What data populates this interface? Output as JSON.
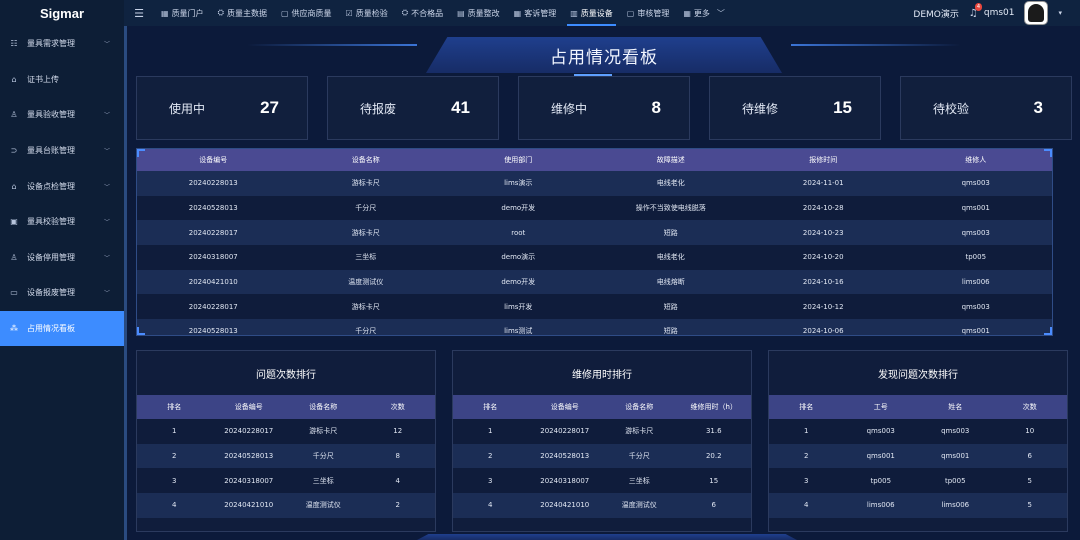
{
  "brand": "Sigmar",
  "nav": [
    {
      "icon": "▦",
      "label": "质量门户"
    },
    {
      "icon": "⛭",
      "label": "质量主数据"
    },
    {
      "icon": "▢",
      "label": "供应商质量"
    },
    {
      "icon": "☑",
      "label": "质量检验"
    },
    {
      "icon": "⛭",
      "label": "不合格品"
    },
    {
      "icon": "▤",
      "label": "质量整改"
    },
    {
      "icon": "▦",
      "label": "客诉管理"
    },
    {
      "icon": "▥",
      "label": "质量设备"
    },
    {
      "icon": "▢",
      "label": "审核管理"
    },
    {
      "icon": "▦",
      "label": "更多"
    }
  ],
  "top_right": {
    "company": "DEMO演示",
    "notifications": "4",
    "user": "qms01"
  },
  "sidebar": [
    {
      "icon": "☷",
      "label": "量具需求管理",
      "chevron": "﹀"
    },
    {
      "icon": "⌂",
      "label": "证书上传",
      "chevron": ""
    },
    {
      "icon": "♙",
      "label": "量具验收管理",
      "chevron": "﹀"
    },
    {
      "icon": "⊃",
      "label": "量具台账管理",
      "chevron": "﹀"
    },
    {
      "icon": "⌂",
      "label": "设备点检管理",
      "chevron": "﹀"
    },
    {
      "icon": "▣",
      "label": "量具校验管理",
      "chevron": "﹀"
    },
    {
      "icon": "♙",
      "label": "设备停用管理",
      "chevron": "﹀"
    },
    {
      "icon": "▭",
      "label": "设备报废管理",
      "chevron": "﹀"
    },
    {
      "icon": "⁂",
      "label": "占用情况看板",
      "chevron": ""
    }
  ],
  "dashboard_title": "占用情况看板",
  "stats": [
    {
      "label": "使用中",
      "value": "27"
    },
    {
      "label": "待报废",
      "value": "41"
    },
    {
      "label": "维修中",
      "value": "8"
    },
    {
      "label": "待维修",
      "value": "15"
    },
    {
      "label": "待校验",
      "value": "3"
    }
  ],
  "repair_table": {
    "headers": [
      "设备编号",
      "设备名称",
      "使用部门",
      "故障描述",
      "报修时间",
      "维修人"
    ],
    "rows": [
      [
        "20240228013",
        "游标卡尺",
        "lims演示",
        "电线老化",
        "2024-11-01",
        "qms003"
      ],
      [
        "20240528013",
        "千分尺",
        "demo开发",
        "操作不当致使电线脱落",
        "2024-10-28",
        "qms001"
      ],
      [
        "20240228017",
        "游标卡尺",
        "root",
        "短路",
        "2024-10-23",
        "qms003"
      ],
      [
        "20240318007",
        "三坐标",
        "demo演示",
        "电线老化",
        "2024-10-20",
        "tp005"
      ],
      [
        "20240421010",
        "温度测试仪",
        "demo开发",
        "电线熔断",
        "2024-10-16",
        "lims006"
      ],
      [
        "20240228017",
        "游标卡尺",
        "lims开发",
        "短路",
        "2024-10-12",
        "qms003"
      ],
      [
        "20240528013",
        "千分尺",
        "lims测试",
        "短路",
        "2024-10-06",
        "qms001"
      ]
    ]
  },
  "panels": [
    {
      "title": "问题次数排行",
      "headers": [
        "排名",
        "设备编号",
        "设备名称",
        "次数"
      ],
      "rows": [
        [
          "1",
          "20240228017",
          "游标卡尺",
          "12"
        ],
        [
          "2",
          "20240528013",
          "千分尺",
          "8"
        ],
        [
          "3",
          "20240318007",
          "三坐标",
          "4"
        ],
        [
          "4",
          "20240421010",
          "温度测试仪",
          "2"
        ]
      ]
    },
    {
      "title": "维修用时排行",
      "headers": [
        "排名",
        "设备编号",
        "设备名称",
        "维修用时（h）"
      ],
      "rows": [
        [
          "1",
          "20240228017",
          "游标卡尺",
          "31.6"
        ],
        [
          "2",
          "20240528013",
          "千分尺",
          "20.2"
        ],
        [
          "3",
          "20240318007",
          "三坐标",
          "15"
        ],
        [
          "4",
          "20240421010",
          "温度测试仪",
          "6"
        ]
      ]
    },
    {
      "title": "发现问题次数排行",
      "headers": [
        "排名",
        "工号",
        "姓名",
        "次数"
      ],
      "rows": [
        [
          "1",
          "qms003",
          "qms003",
          "10"
        ],
        [
          "2",
          "qms001",
          "qms001",
          "6"
        ],
        [
          "3",
          "tp005",
          "tp005",
          "5"
        ],
        [
          "4",
          "lims006",
          "lims006",
          "5"
        ]
      ]
    }
  ],
  "colors": {
    "accent": "#3d8cff",
    "header_bg": "#4a4a92",
    "panel_bg": "#101d3c"
  }
}
